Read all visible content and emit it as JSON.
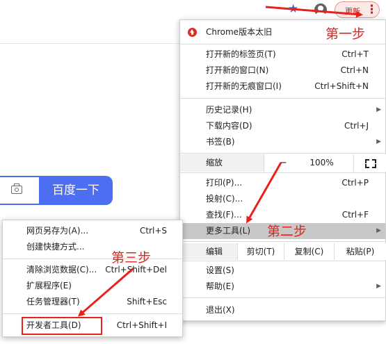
{
  "toolbar": {
    "star_icon": "star-icon",
    "profile_icon": "profile-icon",
    "update_label": "更新",
    "menu_icon": "three-dots-vertical-icon"
  },
  "baidu": {
    "camera_icon": "camera-icon",
    "search_button": "百度一下"
  },
  "menu": {
    "update_item": "Chrome版本太旧",
    "new_tab": {
      "label": "打开新的标签页(T)",
      "shortcut": "Ctrl+T"
    },
    "new_window": {
      "label": "打开新的窗口(N)",
      "shortcut": "Ctrl+N"
    },
    "incognito": {
      "label": "打开新的无痕窗口(I)",
      "shortcut": "Ctrl+Shift+N"
    },
    "history": {
      "label": "历史记录(H)"
    },
    "downloads": {
      "label": "下载内容(D)",
      "shortcut": "Ctrl+J"
    },
    "bookmarks": {
      "label": "书签(B)"
    },
    "zoom": {
      "label": "缩放",
      "minus": "−",
      "value": "100%",
      "plus": "+"
    },
    "print": {
      "label": "打印(P)...",
      "shortcut": "Ctrl+P"
    },
    "cast": {
      "label": "投射(C)..."
    },
    "find": {
      "label": "查找(F)...",
      "shortcut": "Ctrl+F"
    },
    "more_tools": {
      "label": "更多工具(L)"
    },
    "edit": {
      "label": "编辑",
      "cut": "剪切(T)",
      "copy": "复制(C)",
      "paste": "粘贴(P)"
    },
    "settings": {
      "label": "设置(S)"
    },
    "help": {
      "label": "帮助(E)"
    },
    "exit": {
      "label": "退出(X)"
    }
  },
  "submenu": {
    "save_page": {
      "label": "网页另存为(A)...",
      "shortcut": "Ctrl+S"
    },
    "create_shortcut": {
      "label": "创建快捷方式..."
    },
    "clear_data": {
      "label": "清除浏览数据(C)...",
      "shortcut": "Ctrl+Shift+Del"
    },
    "extensions": {
      "label": "扩展程序(E)"
    },
    "task_manager": {
      "label": "任务管理器(T)",
      "shortcut": "Shift+Esc"
    },
    "devtools": {
      "label": "开发者工具(D)",
      "shortcut": "Ctrl+Shift+I"
    }
  },
  "annotations": {
    "step1": "第一步",
    "step2": "第二步",
    "step3": "第三步",
    "color": "#e8211b"
  },
  "colors": {
    "baidu_blue": "#4e6ef2",
    "highlight": "#c8c8c8",
    "update_red": "#d93025"
  }
}
